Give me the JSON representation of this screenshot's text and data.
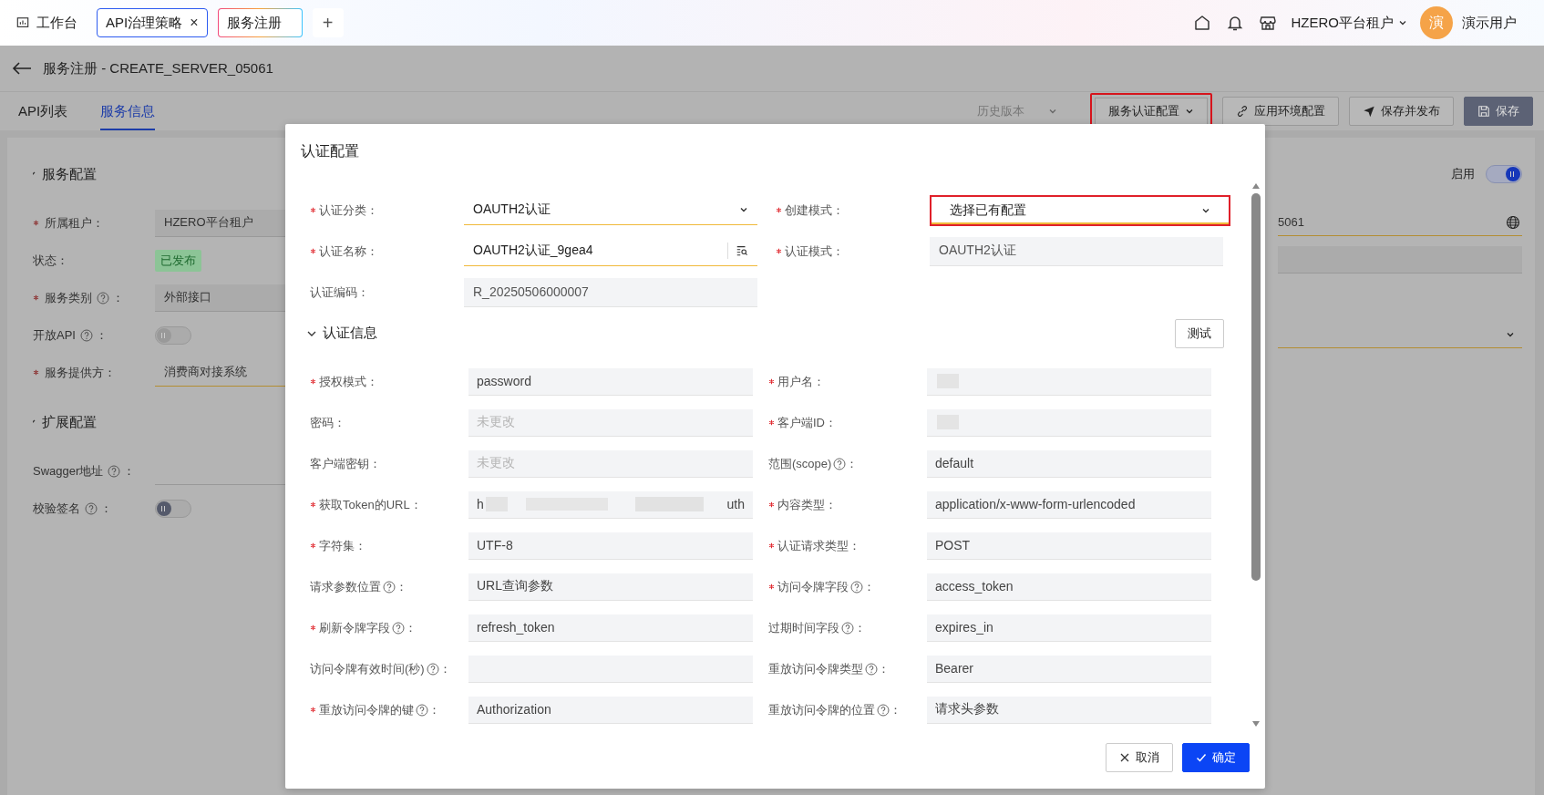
{
  "top_bar": {
    "tabs": [
      {
        "label": "工作台",
        "icon": true,
        "closable": false,
        "selected": false
      },
      {
        "label": "API治理策略",
        "icon": false,
        "closable": true,
        "close_glyph": "×",
        "selected": false
      },
      {
        "label": "服务注册",
        "icon": false,
        "closable": false,
        "selected": true
      }
    ],
    "add_glyph": "+",
    "tenant": "HZERO平台租户",
    "avatar_char": "演",
    "user": "演示用户"
  },
  "header": {
    "title": "服务注册 - CREATE_SERVER_05061"
  },
  "page_tabs": [
    {
      "label": "API列表",
      "selected": false
    },
    {
      "label": "服务信息",
      "selected": true
    }
  ],
  "toolbar": [
    {
      "kind": "dropdown",
      "label": "历史版本",
      "disabled": true,
      "highlighted": false
    },
    {
      "kind": "dropdown",
      "label": "服务认证配置",
      "disabled": false,
      "highlighted": true
    },
    {
      "kind": "link",
      "label": "应用环境配置",
      "disabled": false,
      "highlighted": false
    },
    {
      "kind": "send",
      "label": "保存并发布",
      "disabled": false,
      "highlighted": false
    },
    {
      "kind": "save",
      "label": "保存",
      "disabled": false,
      "highlighted": false
    }
  ],
  "sections": [
    {
      "title": "服务配置",
      "fields": [
        {
          "kind": "input",
          "label": "所属租户：",
          "required": true,
          "help": false,
          "disabled": true,
          "value": "HZERO平台租户"
        },
        {
          "kind": "tag",
          "label": "状态：",
          "required": false,
          "help": false,
          "value": "已发布"
        },
        {
          "kind": "input",
          "label": "服务类别",
          "label_end": "：",
          "required": true,
          "help": true,
          "disabled": true,
          "value": "外部接口"
        },
        {
          "kind": "switch",
          "label": "开放API",
          "label_end": "：",
          "required": false,
          "help": true,
          "disabled": true,
          "on": false
        },
        {
          "kind": "input",
          "label": "服务提供方：",
          "required": true,
          "help": false,
          "disabled": false,
          "value": "消费商对接系统"
        }
      ]
    },
    {
      "title": "扩展配置",
      "fields": [
        {
          "kind": "input",
          "label": "Swagger地址",
          "label_end": "：",
          "required": false,
          "help": true,
          "disabled": false
        },
        {
          "kind": "switch",
          "label": "校验签名",
          "label_end": "：",
          "required": false,
          "help": true,
          "disabled": false,
          "on": false
        }
      ]
    }
  ],
  "right_panel": {
    "enable": {
      "label": "启用",
      "on": true
    },
    "fields": [
      {
        "kind": "input",
        "value": "5061",
        "disabled": false,
        "globe": true
      },
      {
        "kind": "input",
        "disabled": true,
        "globe": false
      },
      {
        "kind": "select",
        "disabled": false,
        "globe": false
      }
    ]
  },
  "modal": {
    "title": "认证配置",
    "fields": [
      {
        "kind": "select",
        "label": "认证分类：",
        "required": true,
        "disabled": false,
        "highlighted": false,
        "value": "OAUTH2认证"
      },
      {
        "kind": "select",
        "label": "创建模式：",
        "required": true,
        "disabled": false,
        "highlighted": true,
        "value": "选择已有配置"
      },
      {
        "kind": "lookup",
        "label": "认证名称：",
        "required": true,
        "disabled": false,
        "highlighted": false,
        "value": "OAUTH2认证_9gea4"
      },
      {
        "kind": "input",
        "label": "认证模式：",
        "required": true,
        "disabled": true,
        "highlighted": false,
        "value": "OAUTH2认证"
      },
      {
        "kind": "input",
        "label": "认证编码：",
        "required": false,
        "disabled": true,
        "highlighted": false,
        "value": "R_20250506000007"
      }
    ],
    "section": {
      "title": "认证信息",
      "expanded": true,
      "test_button": "测试"
    },
    "auth_fields": [
      {
        "label": "授权模式：",
        "required": true,
        "help": false,
        "value": "password"
      },
      {
        "label": "用户名：",
        "required": true,
        "help": false,
        "redacted": true
      },
      {
        "label": "密码：",
        "required": false,
        "help": false,
        "placeholder": "未更改"
      },
      {
        "label": "客户端ID：",
        "required": true,
        "help": false,
        "redacted": true
      },
      {
        "label": "客户端密钥：",
        "required": false,
        "help": false,
        "placeholder": "未更改"
      },
      {
        "label": "范围(scope)",
        "label_end": "：",
        "required": false,
        "help": true,
        "value": "default"
      },
      {
        "label": "获取Token的URL：",
        "required": true,
        "help": false,
        "redacted": true,
        "value_start": "h",
        "value_end": "uth"
      },
      {
        "label": "内容类型：",
        "required": true,
        "help": false,
        "value": "application/x-www-form-urlencoded"
      },
      {
        "label": "字符集：",
        "required": true,
        "help": false,
        "value": "UTF-8"
      },
      {
        "label": "认证请求类型：",
        "required": true,
        "help": false,
        "value": "POST"
      },
      {
        "label": "请求参数位置",
        "label_end": "：",
        "required": false,
        "help": true,
        "value": "URL查询参数"
      },
      {
        "label": "访问令牌字段",
        "label_end": "：",
        "required": true,
        "help": true,
        "value": "access_token"
      },
      {
        "label": "刷新令牌字段",
        "label_end": "：",
        "required": true,
        "help": true,
        "value": "refresh_token"
      },
      {
        "label": "过期时间字段",
        "label_end": "：",
        "required": false,
        "help": true,
        "value": "expires_in"
      },
      {
        "label": "访问令牌有效时间(秒)",
        "label_end": "：",
        "required": false,
        "help": true
      },
      {
        "label": "重放访问令牌类型",
        "label_end": "：",
        "required": false,
        "help": true,
        "value": "Bearer"
      },
      {
        "label": "重放访问令牌的键",
        "label_end": "：",
        "required": true,
        "help": true,
        "value": "Authorization"
      },
      {
        "label": "重放访问令牌的位置",
        "label_end": "：",
        "required": false,
        "help": true,
        "value": "请求头参数"
      }
    ],
    "buttons": [
      {
        "kind": "cancel",
        "label": "取消"
      },
      {
        "kind": "ok",
        "label": "确定"
      }
    ]
  }
}
